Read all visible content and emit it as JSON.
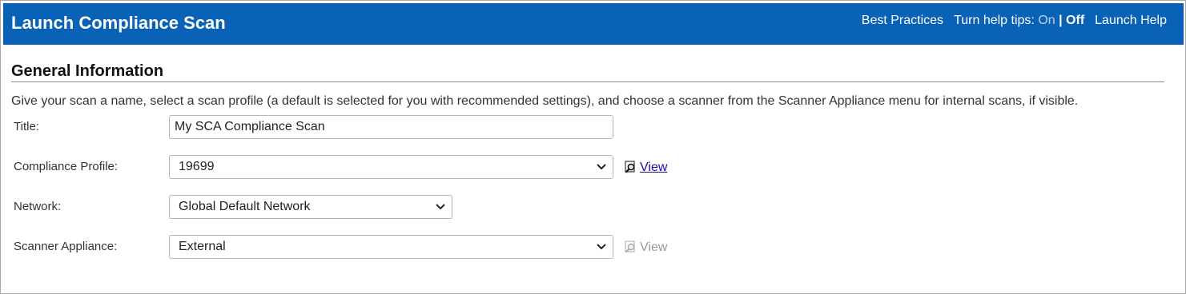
{
  "header": {
    "title": "Launch Compliance Scan",
    "best_practices": "Best Practices",
    "help_tips_label": "Turn help tips:",
    "help_tips_on": "On",
    "help_tips_separator": "|",
    "help_tips_off": "Off",
    "launch_help": "Launch Help",
    "background_color": "#0a62b6"
  },
  "section": {
    "title": "General Information",
    "description": "Give your scan a name, select a scan profile (a default is selected for you with recommended settings), and choose a scanner from the Scanner Appliance menu for internal scans, if visible."
  },
  "form": {
    "title": {
      "label": "Title:",
      "value": "My SCA Compliance Scan"
    },
    "compliance_profile": {
      "label": "Compliance Profile:",
      "value": "19699",
      "view_label": "View",
      "view_icon": "magnifier-document-icon"
    },
    "network": {
      "label": "Network:",
      "value": "Global Default Network"
    },
    "scanner_appliance": {
      "label": "Scanner Appliance:",
      "value": "External",
      "view_label": "View",
      "view_disabled": true
    }
  }
}
